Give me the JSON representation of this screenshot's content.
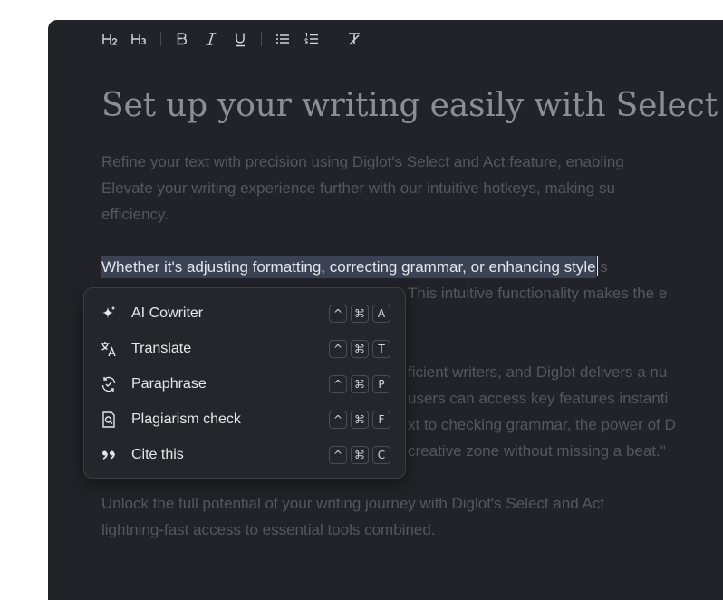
{
  "toolbar": {
    "h2": "H2",
    "h3": "H3",
    "bold": "B",
    "italic": "I",
    "underline": "U"
  },
  "document": {
    "heading": "Set up your writing easily with Select and Act",
    "p1": [
      "Refine your text with precision using Diglot's Select and Act feature, enabling",
      "Elevate your writing experience further with our intuitive hotkeys, making su",
      "efficiency."
    ],
    "p2": {
      "selected": "Whether it's adjusting formatting, correcting grammar, or enhancing style",
      "after": "s",
      "line2": "This intuitive functionality makes the e"
    },
    "p3": [
      "ficient writers, and Diglot delivers a nu",
      "users can access key features instanti",
      "xt to checking grammar, the power of D",
      "creative zone without missing a beat.\""
    ],
    "p4": [
      "Unlock the full potential of your writing journey with Diglot's Select and Act",
      "lightning-fast access to essential tools combined."
    ]
  },
  "menu": {
    "items": [
      {
        "icon": "sparkle-icon",
        "label": "AI Cowriter",
        "keys": [
          "^",
          "⌘",
          "A"
        ]
      },
      {
        "icon": "translate-icon",
        "label": "Translate",
        "keys": [
          "^",
          "⌘",
          "T"
        ]
      },
      {
        "icon": "paraphrase-icon",
        "label": "Paraphrase",
        "keys": [
          "^",
          "⌘",
          "P"
        ]
      },
      {
        "icon": "plagiarism-icon",
        "label": "Plagiarism check",
        "keys": [
          "^",
          "⌘",
          "F"
        ]
      },
      {
        "icon": "quote-icon",
        "label": "Cite this",
        "keys": [
          "^",
          "⌘",
          "C"
        ]
      }
    ]
  },
  "colors": {
    "background": "#222328",
    "menu_background": "#25262b",
    "selection": "#3a4253",
    "muted_text": "#55575e",
    "heading_text": "#8c8e94"
  }
}
